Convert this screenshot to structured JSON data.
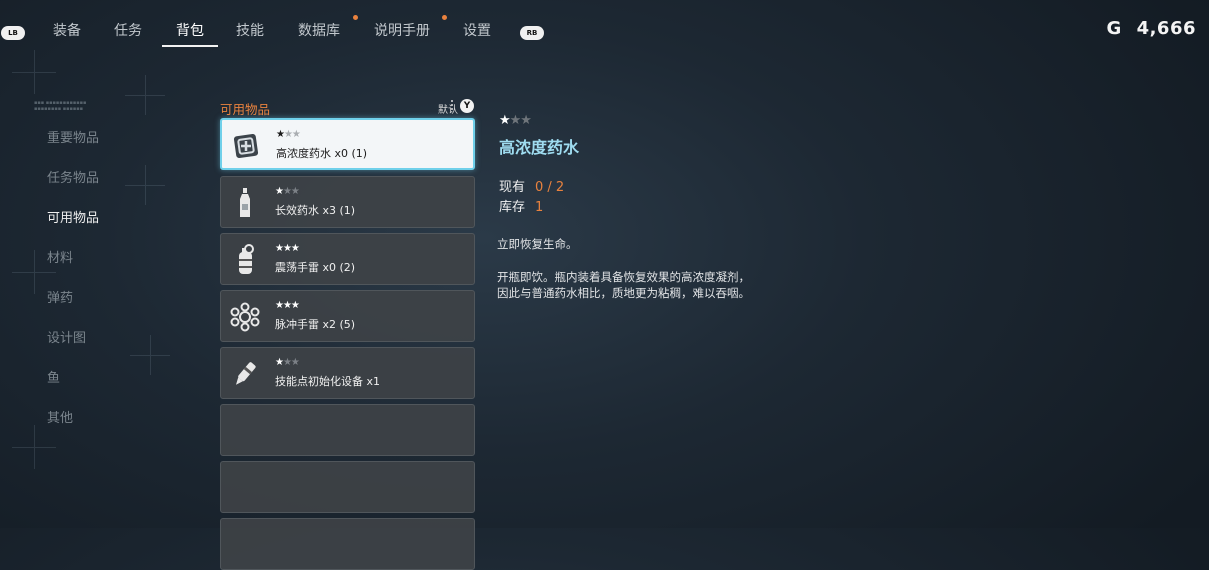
{
  "nav": {
    "left_bumper": "LB",
    "right_bumper": "RB",
    "tabs": [
      {
        "label": "装备",
        "active": false,
        "badge": false
      },
      {
        "label": "任务",
        "active": false,
        "badge": false
      },
      {
        "label": "背包",
        "active": true,
        "badge": false
      },
      {
        "label": "技能",
        "active": false,
        "badge": false
      },
      {
        "label": "数据库",
        "active": false,
        "badge": true
      },
      {
        "label": "说明手册",
        "active": false,
        "badge": true
      },
      {
        "label": "设置",
        "active": false,
        "badge": false
      }
    ],
    "currency_symbol": "G",
    "currency_value": "4,666"
  },
  "categories": [
    {
      "label": "重要物品",
      "active": false
    },
    {
      "label": "任务物品",
      "active": false
    },
    {
      "label": "可用物品",
      "active": true
    },
    {
      "label": "材料",
      "active": false
    },
    {
      "label": "弹药",
      "active": false
    },
    {
      "label": "设计图",
      "active": false
    },
    {
      "label": "鱼",
      "active": false
    },
    {
      "label": "其他",
      "active": false
    }
  ],
  "list": {
    "title": "可用物品",
    "sort_label": "默认",
    "sort_button": "Y",
    "items": [
      {
        "name": "高浓度药水 x0 (1)",
        "stars": 1,
        "icon": "high-potion-icon",
        "selected": true
      },
      {
        "name": "长效药水 x3 (1)",
        "stars": 1,
        "icon": "long-potion-icon",
        "selected": false
      },
      {
        "name": "震荡手雷 x0 (2)",
        "stars": 3,
        "icon": "concussion-grenade-icon",
        "selected": false
      },
      {
        "name": "脉冲手雷 x2 (5)",
        "stars": 3,
        "icon": "pulse-grenade-icon",
        "selected": false
      },
      {
        "name": "技能点初始化设备 x1",
        "stars": 1,
        "icon": "skill-reset-device-icon",
        "selected": false
      }
    ],
    "empty_slots": 3
  },
  "detail": {
    "stars": 1,
    "name": "高浓度药水",
    "owned_label": "现有",
    "owned_value": "0 / 2",
    "stock_label": "库存",
    "stock_value": "1",
    "effect": "立即恢复生命。",
    "description_line1": "开瓶即饮。瓶内装着具备恢复效果的高浓度凝剂，",
    "description_line2": "因此与普通药水相比，质地更为粘稠，难以吞咽。"
  },
  "colors": {
    "accent": "#e9823e",
    "highlight": "#6fd0ea",
    "title": "#9fdcf0"
  }
}
